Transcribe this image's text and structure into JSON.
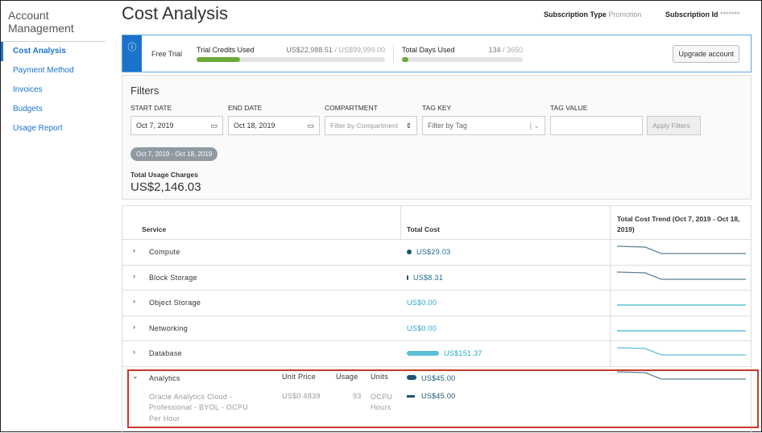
{
  "sidebar": {
    "title": "Account Management",
    "items": [
      {
        "label": "Cost Analysis",
        "active": true
      },
      {
        "label": "Payment Method"
      },
      {
        "label": "Invoices"
      },
      {
        "label": "Budgets"
      },
      {
        "label": "Usage Report"
      }
    ]
  },
  "header": {
    "title": "Cost Analysis",
    "subscription_type_label": "Subscription Type",
    "subscription_type": "Promotion",
    "subscription_id_label": "Subscription Id",
    "subscription_id": "*******"
  },
  "banner": {
    "icon": "info-icon",
    "plan": "Free Trial",
    "credits_label": "Trial Credits Used",
    "credits_value": "US$22,988.51",
    "credits_total": " / US$99,999.00",
    "credits_fraction": 0.23,
    "days_label": "Total Days Used",
    "days_value": "134",
    "days_total": " / 3650",
    "days_fraction": 0.037,
    "upgrade": "Upgrade account",
    "bar_color": "#6aaa3a"
  },
  "filters": {
    "title": "Filters",
    "start_label": "START DATE",
    "start_value": "Oct 7, 2019",
    "end_label": "END DATE",
    "end_value": "Oct 18, 2019",
    "compartment_label": "COMPARTMENT",
    "compartment_placeholder": "Filter by Compartment",
    "tagkey_label": "TAG KEY",
    "tagkey_placeholder": "Filter by Tag",
    "tagvalue_label": "TAG VALUE",
    "tagvalue_value": "",
    "apply": "Apply Filters",
    "chip": "Oct 7, 2019 - Oct 18, 2019",
    "total_label": "Total Usage Charges",
    "total_value": "US$2,146.03"
  },
  "table": {
    "headers": {
      "service": "Service",
      "total_cost": "Total Cost",
      "trend": "Total Cost Trend (Oct 7, 2019 - Oct 18, 2019)",
      "unit_price": "Unit Price",
      "usage": "Usage",
      "units": "Units"
    },
    "rows": [
      {
        "service": "Compute",
        "cost": "US$29.03",
        "color": "#1d5470"
      },
      {
        "service": "Block Storage",
        "cost": "US$8.31",
        "color": "#1d5470"
      },
      {
        "service": "Object Storage",
        "cost": "US$0.00",
        "color": "#3db3cc"
      },
      {
        "service": "Networking",
        "cost": "US$0.00",
        "color": "#3db3cc"
      },
      {
        "service": "Database",
        "cost": "US$151.37",
        "color": "#5bbfd6"
      }
    ],
    "expanded": {
      "service": "Analytics",
      "cost": "US$45.00",
      "detail": {
        "name": "Oracle Analytics Cloud - Professional - BYOL - OCPU Per Hour",
        "unit_price": "US$0.4839",
        "usage": "93",
        "units": "OCPU Hours",
        "cost": "US$45.00"
      }
    }
  }
}
